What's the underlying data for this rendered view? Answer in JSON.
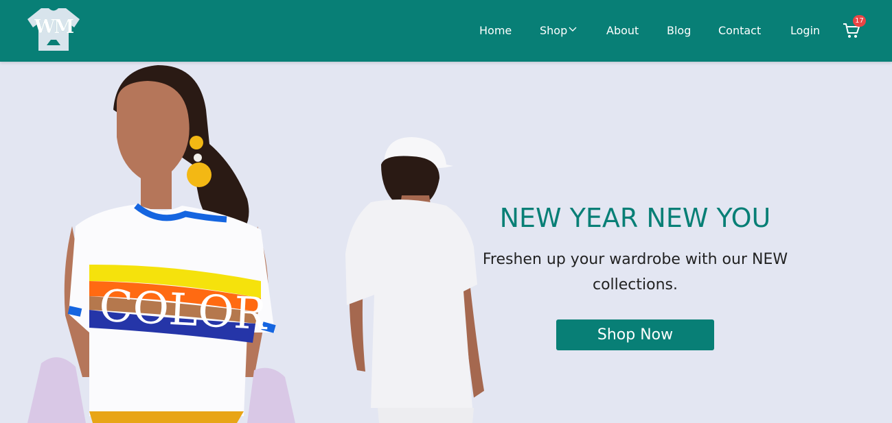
{
  "header": {
    "logo_text": "WM",
    "nav": {
      "home": "Home",
      "shop": "Shop",
      "about": "About",
      "blog": "Blog",
      "contact": "Contact",
      "login": "Login"
    },
    "cart_count": "17",
    "cart_icon": "shopping-cart-icon",
    "shop_dropdown_icon": "chevron-down-icon"
  },
  "hero": {
    "title": "NEW YEAR NEW YOU",
    "subtitle_line1": "Freshen up your wardrobe with our NEW",
    "subtitle_line2": "collections.",
    "button_label": "Shop Now",
    "shirt_print": "COLOR"
  },
  "colors": {
    "brand": "#087f76",
    "hero_background": "#e3e6f2",
    "badge": "#e84545",
    "text_dark": "#222222"
  }
}
